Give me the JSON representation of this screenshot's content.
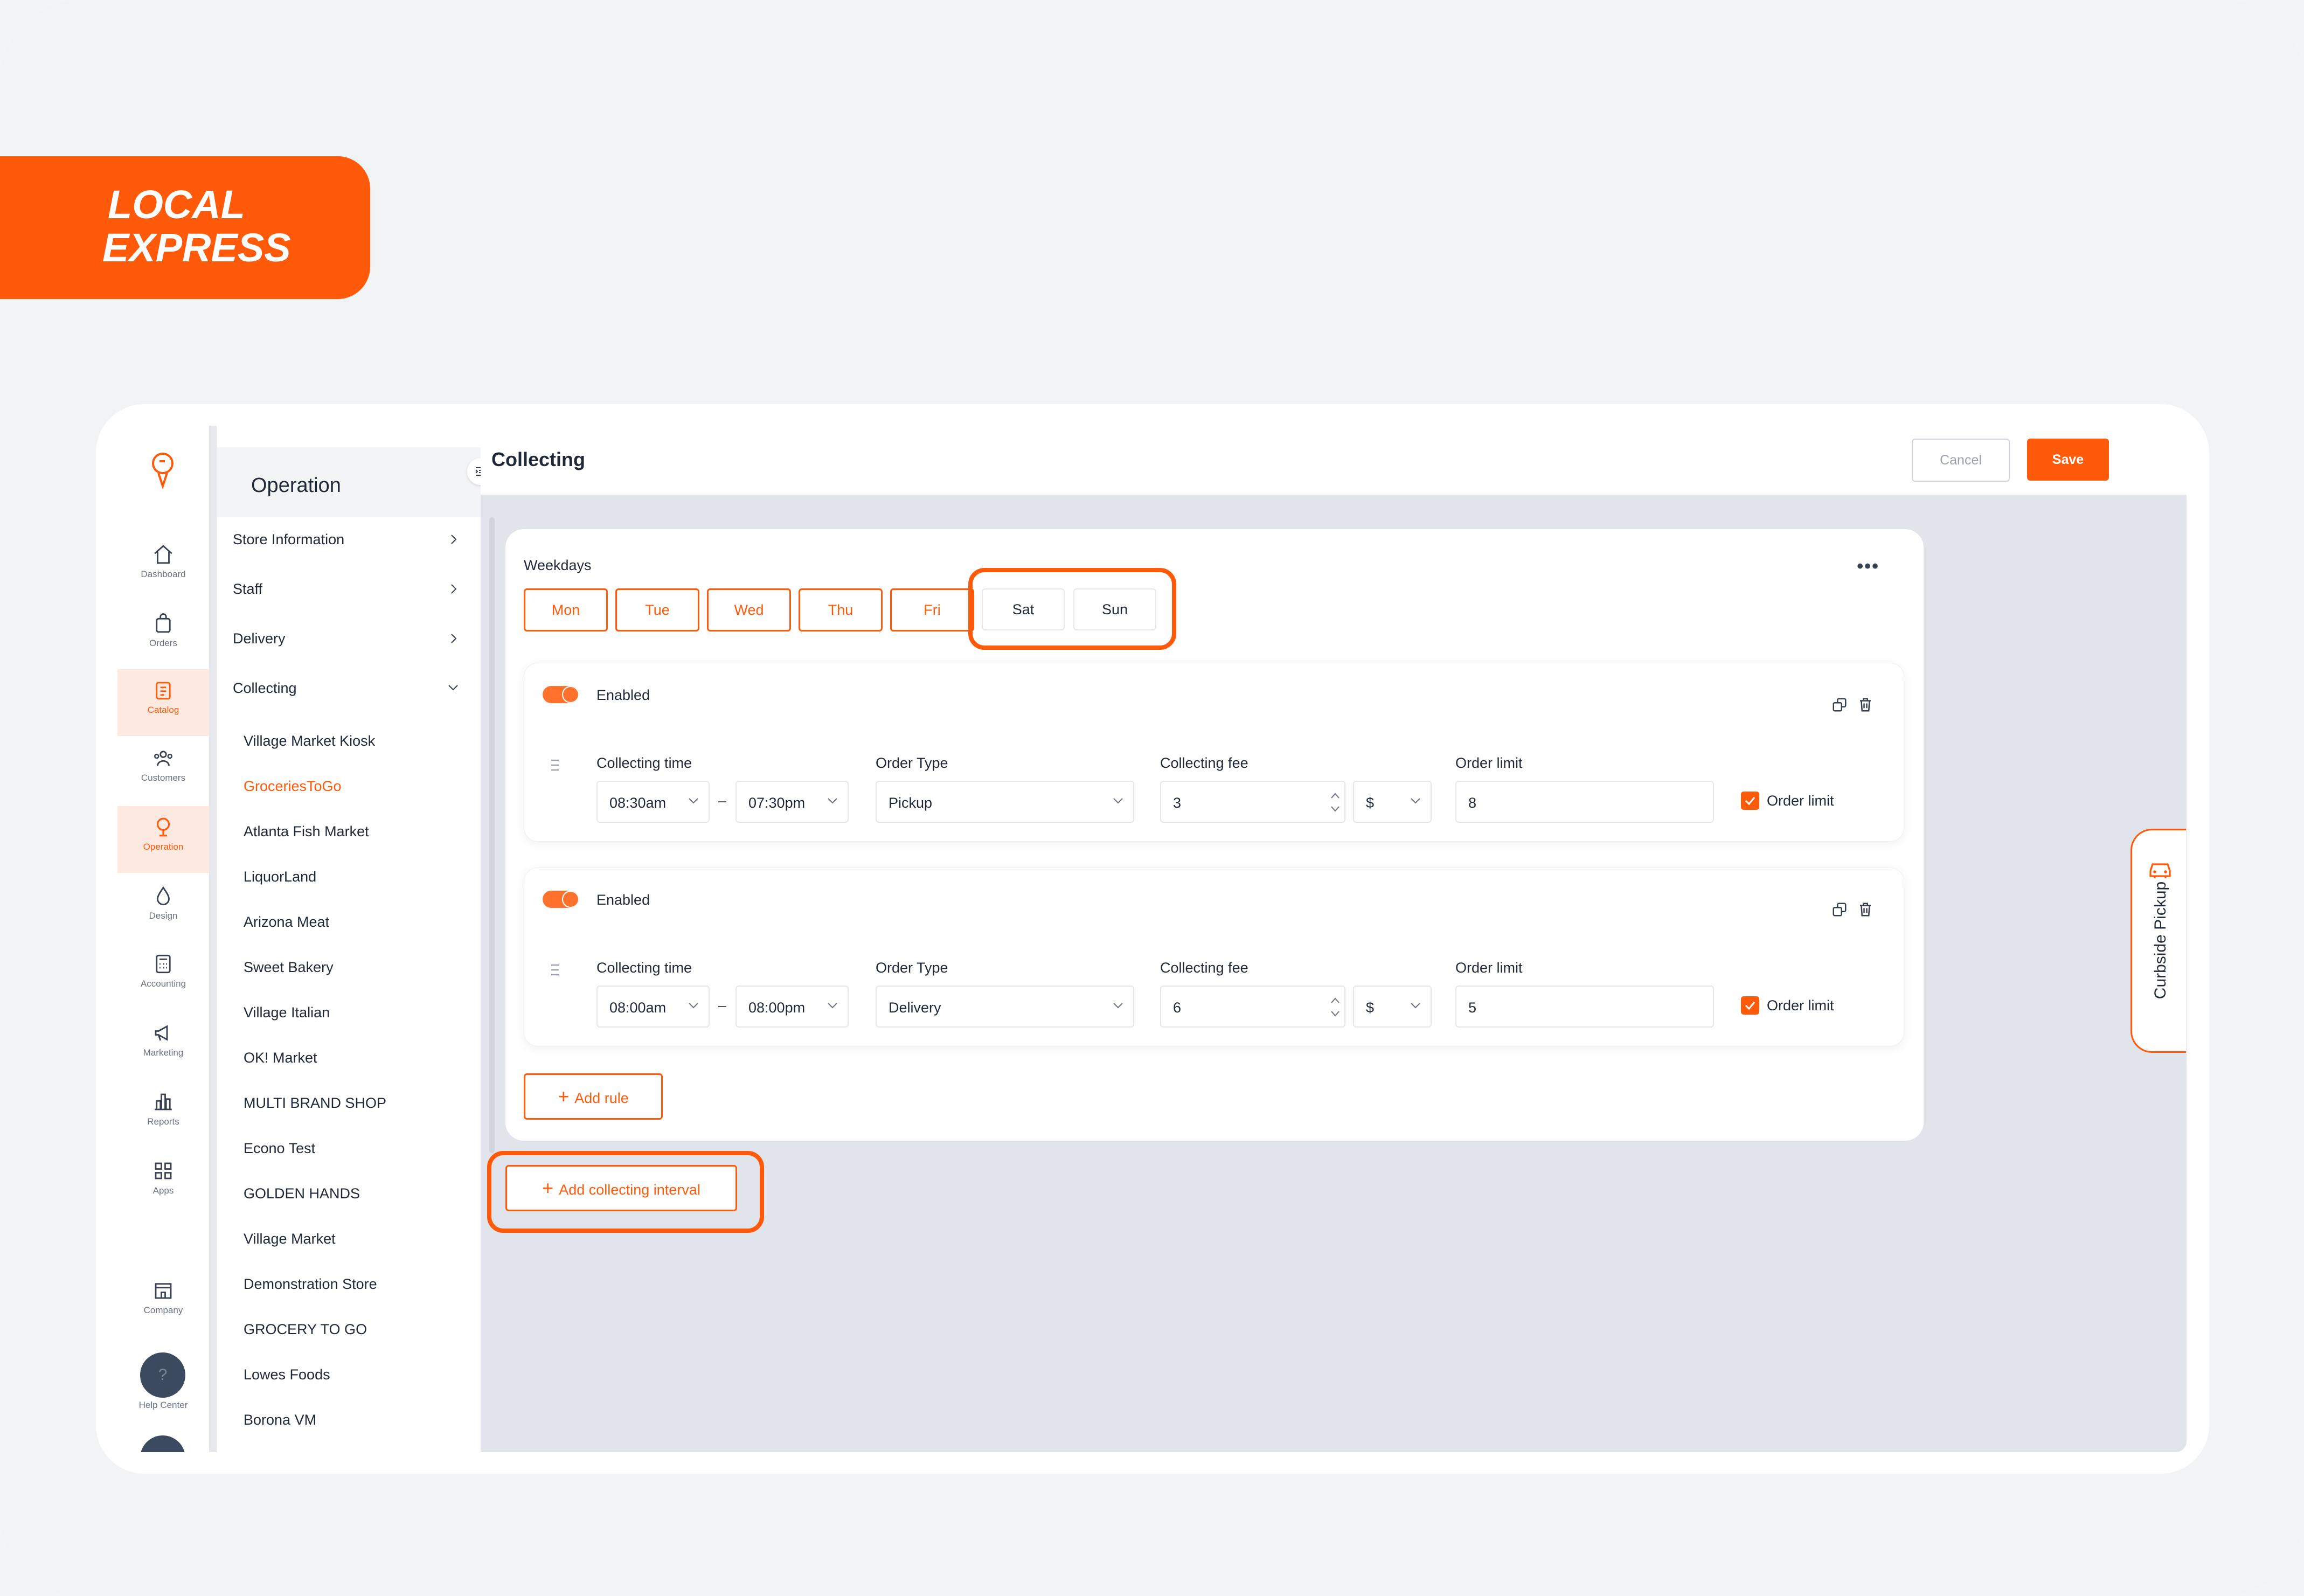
{
  "brand": {
    "logo_text_line1": "LOCAL",
    "logo_text_line2": "EXPRESS",
    "accent": "#ff5a0a"
  },
  "rail": {
    "items": [
      {
        "label": "Dashboard",
        "icon": "home-icon"
      },
      {
        "label": "Orders",
        "icon": "bag-icon"
      },
      {
        "label": "Catalog",
        "icon": "clipboard-icon"
      },
      {
        "label": "Customers",
        "icon": "users-icon"
      },
      {
        "label": "Operation",
        "icon": "operation-icon"
      },
      {
        "label": "Design",
        "icon": "droplet-icon"
      },
      {
        "label": "Accounting",
        "icon": "calculator-icon"
      },
      {
        "label": "Marketing",
        "icon": "megaphone-icon"
      },
      {
        "label": "Reports",
        "icon": "bar-chart-icon"
      },
      {
        "label": "Apps",
        "icon": "apps-icon"
      },
      {
        "label": "Company",
        "icon": "store-icon"
      }
    ],
    "help_label": "Help Center",
    "help_glyph": "?"
  },
  "subnav": {
    "title": "Operation",
    "sections": [
      "Store Information",
      "Staff",
      "Delivery",
      "Collecting"
    ],
    "stores": [
      "Village Market Kiosk",
      "GroceriesToGo",
      "Atlanta Fish Market",
      "LiquorLand",
      "Arizona Meat",
      "Sweet Bakery",
      "Village Italian",
      "OK! Market",
      "MULTI BRAND SHOP",
      "Econo Test",
      "GOLDEN HANDS",
      "Village Market",
      "Demonstration Store",
      "GROCERY TO GO",
      "Lowes Foods",
      "Borona VM"
    ],
    "active_store": "GroceriesToGo"
  },
  "header": {
    "title": "Collecting",
    "cancel_label": "Cancel",
    "save_label": "Save"
  },
  "weekdays": {
    "label": "Weekdays",
    "more": "•••",
    "days": [
      {
        "label": "Mon",
        "selected": true
      },
      {
        "label": "Tue",
        "selected": true
      },
      {
        "label": "Wed",
        "selected": true
      },
      {
        "label": "Thu",
        "selected": true
      },
      {
        "label": "Fri",
        "selected": true
      },
      {
        "label": "Sat",
        "selected": false
      },
      {
        "label": "Sun",
        "selected": false
      }
    ]
  },
  "rules": [
    {
      "enabled_label": "Enabled",
      "time_label": "Collecting time",
      "time_from": "08:30am",
      "time_to": "07:30pm",
      "dash": "–",
      "type_label": "Order Type",
      "type_value": "Pickup",
      "fee_label": "Collecting fee",
      "fee_value": "3",
      "currency": "$",
      "limit_label": "Order limit",
      "limit_value": "8",
      "limit_check_label": "Order limit"
    },
    {
      "enabled_label": "Enabled",
      "time_label": "Collecting time",
      "time_from": "08:00am",
      "time_to": "08:00pm",
      "dash": "–",
      "type_label": "Order Type",
      "type_value": "Delivery",
      "fee_label": "Collecting fee",
      "fee_value": "6",
      "currency": "$",
      "limit_label": "Order limit",
      "limit_value": "5",
      "limit_check_label": "Order limit"
    }
  ],
  "add_rule_label": "Add rule",
  "add_interval_label": "Add collecting interval",
  "plus": "+",
  "curbside_label": "Curbside Pickup"
}
